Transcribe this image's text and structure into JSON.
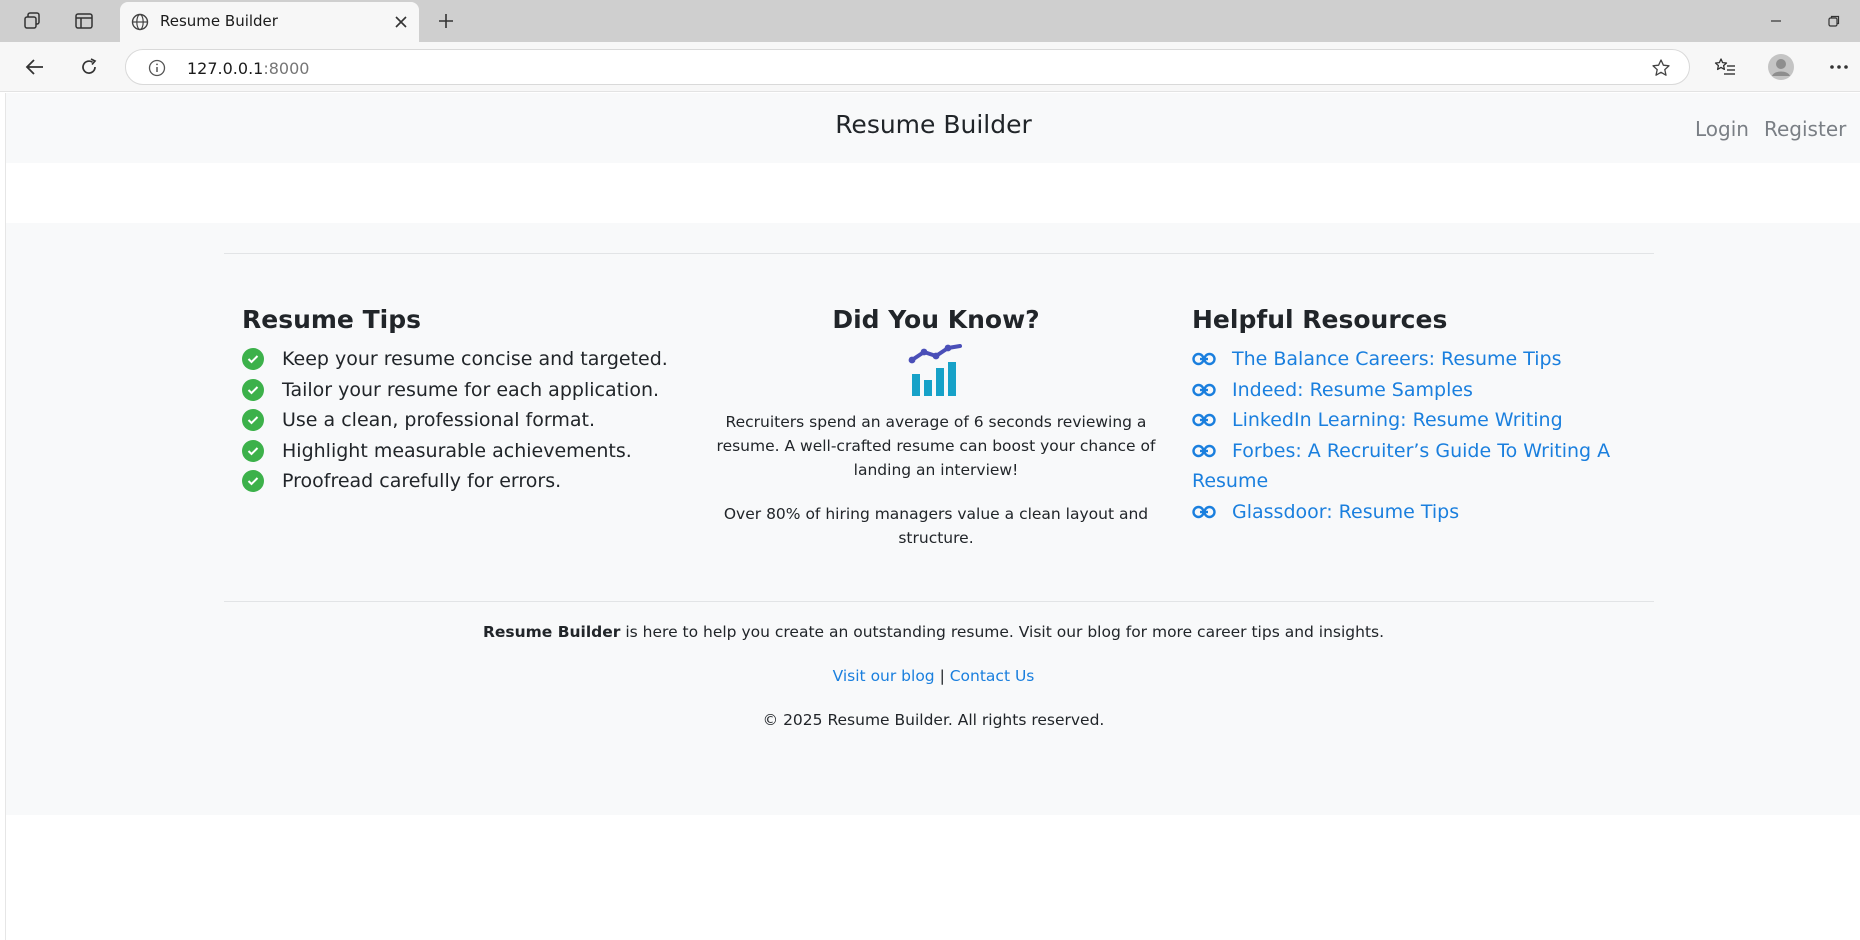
{
  "browser": {
    "tab_title": "Resume Builder",
    "address_host": "127.0.0.1",
    "address_port": ":8000"
  },
  "navbar": {
    "brand": "Resume Builder",
    "login": "Login",
    "register": "Register"
  },
  "tips": {
    "title": "Resume Tips",
    "items": [
      "Keep your resume concise and targeted.",
      "Tailor your resume for each application.",
      "Use a clean, professional format.",
      "Highlight measurable achievements.",
      "Proofread carefully for errors."
    ]
  },
  "did_you_know": {
    "title": "Did You Know?",
    "fact1": "Recruiters spend an average of 6 seconds reviewing a resume. A well-crafted resume can boost your chance of landing an interview!",
    "fact2": "Over 80% of hiring managers value a clean layout and structure."
  },
  "resources": {
    "title": "Helpful Resources",
    "links": [
      "The Balance Careers: Resume Tips",
      "Indeed: Resume Samples",
      "LinkedIn Learning: Resume Writing",
      "Forbes: A Recruiter’s Guide To Writing A Resume",
      "Glassdoor: Resume Tips"
    ]
  },
  "footer": {
    "about_brand": "Resume Builder",
    "about_text": " is here to help you create an outstanding resume. Visit our blog for more career tips and insights.",
    "blog_link": "Visit our blog",
    "separator": " | ",
    "contact_link": "Contact Us",
    "copyright": "© 2025 Resume Builder. All rights reserved."
  },
  "colors": {
    "link": "#1a7fde",
    "check": "#3cb14a",
    "footer_bg": "#f8f9fa"
  }
}
